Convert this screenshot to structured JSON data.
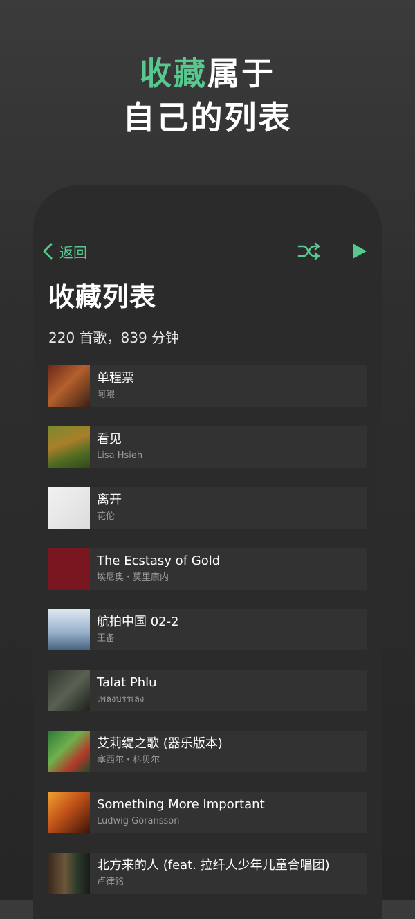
{
  "hero": {
    "line1_accent": "收藏",
    "line1_rest": "属于",
    "line2": "自己的列表"
  },
  "colors": {
    "accent": "#57c98f",
    "phone_bg": "#2b2b2b",
    "row_bg": "#323232"
  },
  "nav": {
    "back_label": "返回",
    "back_icon": "chevron-left-icon",
    "shuffle_icon": "shuffle-icon",
    "play_icon": "play-icon"
  },
  "playlist": {
    "title": "收藏列表",
    "meta": "220 首歌，839 分钟"
  },
  "songs": [
    {
      "title": "单程票",
      "artist": "阿鲲"
    },
    {
      "title": "看见",
      "artist": "Lisa Hsieh"
    },
    {
      "title": "离开",
      "artist": "花伦"
    },
    {
      "title": "The Ecstasy of Gold",
      "artist": "埃尼奥・莫里康内"
    },
    {
      "title": "航拍中国 02-2",
      "artist": "王备"
    },
    {
      "title": "Talat Phlu",
      "artist": "เพลงบรรเลง"
    },
    {
      "title": "艾莉缇之歌 (器乐版本)",
      "artist": "塞西尔・科贝尔"
    },
    {
      "title": "Something More Important",
      "artist": "Ludwig Göransson"
    },
    {
      "title": "北方来的人 (feat. 拉纤人少年儿童合唱团)",
      "artist": "卢律铭"
    }
  ]
}
